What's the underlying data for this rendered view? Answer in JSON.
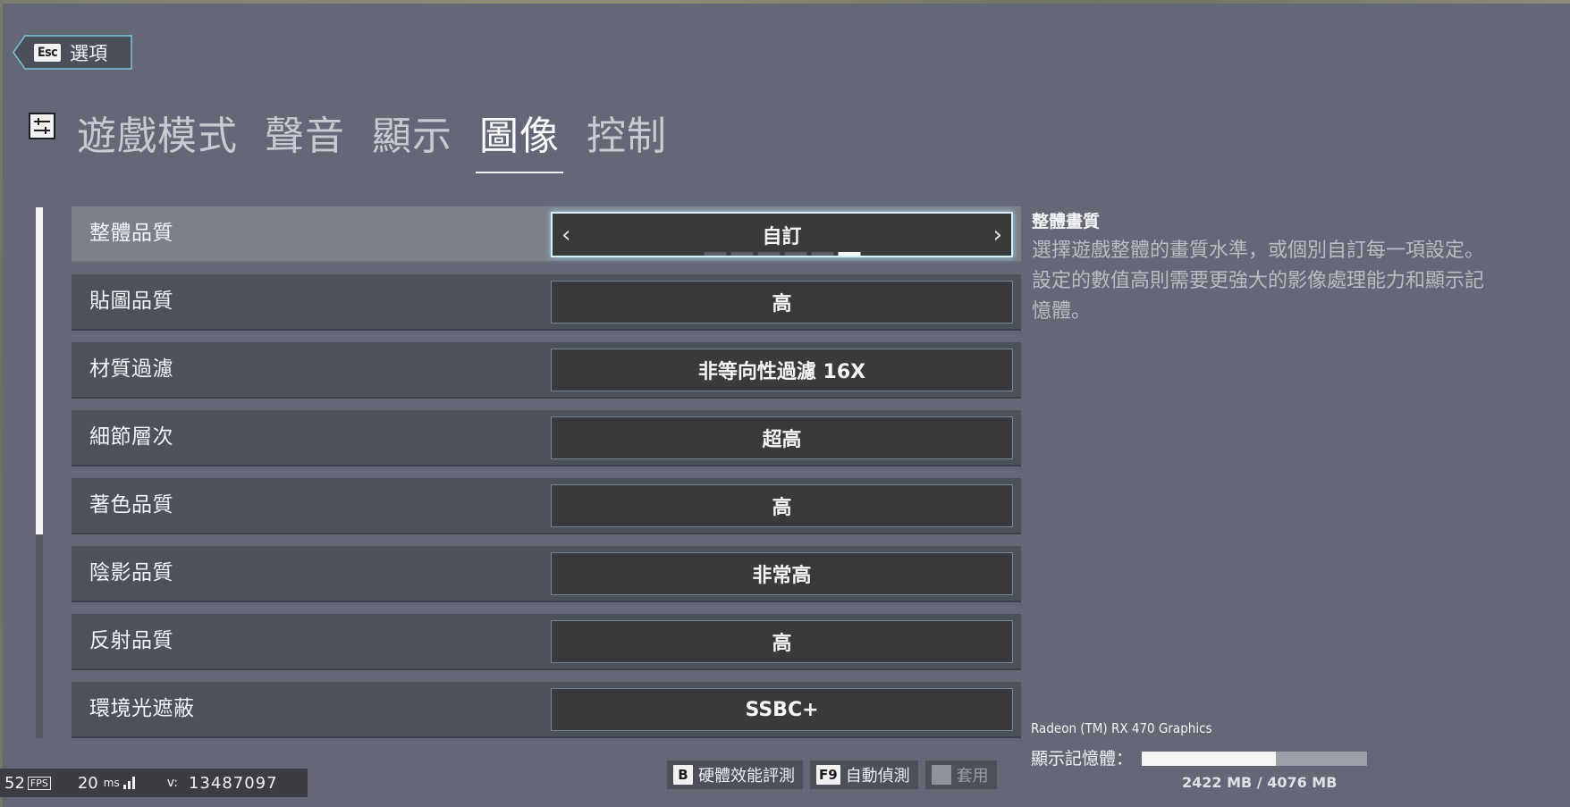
{
  "header": {
    "back_key": "Esc",
    "back_label": "選項"
  },
  "tabs": [
    {
      "label": "遊戲模式",
      "active": false
    },
    {
      "label": "聲音",
      "active": false
    },
    {
      "label": "顯示",
      "active": false
    },
    {
      "label": "圖像",
      "active": true
    },
    {
      "label": "控制",
      "active": false
    }
  ],
  "settings": [
    {
      "label": "整體品質",
      "value": "自訂",
      "selected": true
    },
    {
      "label": "貼圖品質",
      "value": "高"
    },
    {
      "label": "材質過濾",
      "value": "非等向性過濾 16X"
    },
    {
      "label": "細節層次",
      "value": "超高"
    },
    {
      "label": "著色品質",
      "value": "高"
    },
    {
      "label": "陰影品質",
      "value": "非常高"
    },
    {
      "label": "反射品質",
      "value": "高"
    },
    {
      "label": "環境光遮蔽",
      "value": "SSBC+"
    }
  ],
  "quality_levels": {
    "total": 6,
    "active_index": 5
  },
  "description": {
    "title": "整體畫質",
    "body": "選擇遊戲整體的畫質水準，或個別自訂每一項設定。設定的數值高則需要更強大的影像處理能力和顯示記憶體。"
  },
  "gpu": {
    "name": "Radeon (TM) RX 470 Graphics",
    "vram_label": "顯示記憶體：",
    "vram_used_text": "2422 MB / 4076 MB",
    "vram_used_fraction": 0.594
  },
  "actions": [
    {
      "key": "B",
      "label": "硬體效能評測",
      "enabled": true
    },
    {
      "key": "F9",
      "label": "自動偵測",
      "enabled": true
    },
    {
      "key": "",
      "label": "套用",
      "enabled": false
    }
  ],
  "perf": {
    "fps": "52",
    "fps_unit": "FPS",
    "ms": "20",
    "ms_unit": "ms",
    "version_label": "v:",
    "version": "13487097"
  },
  "colors": {
    "background": "#646876",
    "row": "#4d515c",
    "row_selected": "#7c808b",
    "value_box": "#3a3a3c",
    "value_border": "#6f8a96",
    "focus_glow": "#d6f0f7"
  }
}
